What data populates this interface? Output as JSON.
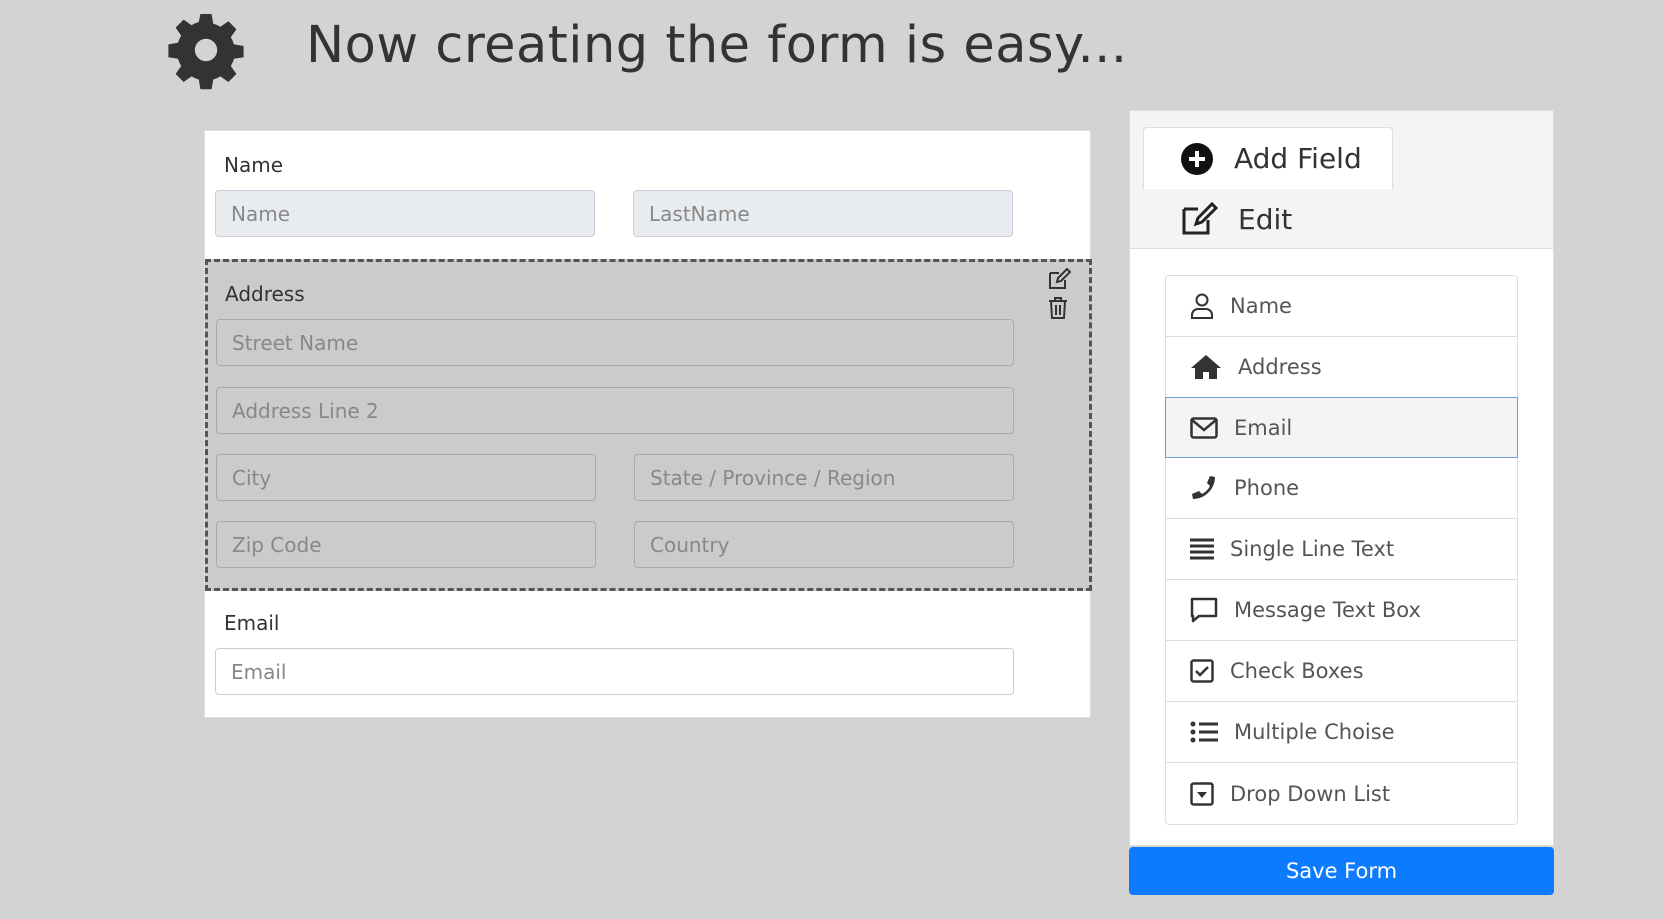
{
  "header": {
    "title": "Now creating the form is easy..."
  },
  "form": {
    "name_section": {
      "label": "Name",
      "first_placeholder": "Name",
      "last_placeholder": "LastName"
    },
    "address_section": {
      "label": "Address",
      "street_placeholder": "Street Name",
      "line2_placeholder": "Address Line 2",
      "city_placeholder": "City",
      "state_placeholder": "State / Province / Region",
      "zip_placeholder": "Zip Code",
      "country_placeholder": "Country"
    },
    "email_section": {
      "label": "Email",
      "email_placeholder": "Email"
    }
  },
  "panel": {
    "tabs": {
      "add_field": "Add Field",
      "edit": "Edit"
    },
    "field_types": [
      {
        "label": "Name",
        "icon": "user-icon"
      },
      {
        "label": "Address",
        "icon": "home-icon"
      },
      {
        "label": "Email",
        "icon": "envelope-icon"
      },
      {
        "label": "Phone",
        "icon": "phone-icon"
      },
      {
        "label": "Single Line Text",
        "icon": "lines-icon"
      },
      {
        "label": "Message Text Box",
        "icon": "comment-icon"
      },
      {
        "label": "Check Boxes",
        "icon": "checkbox-icon"
      },
      {
        "label": "Multiple Choise",
        "icon": "list-icon"
      },
      {
        "label": "Drop Down List",
        "icon": "dropdown-icon"
      }
    ],
    "active_index": 2
  },
  "save_button": {
    "label": "Save Form",
    "color": "#0d7bff"
  }
}
